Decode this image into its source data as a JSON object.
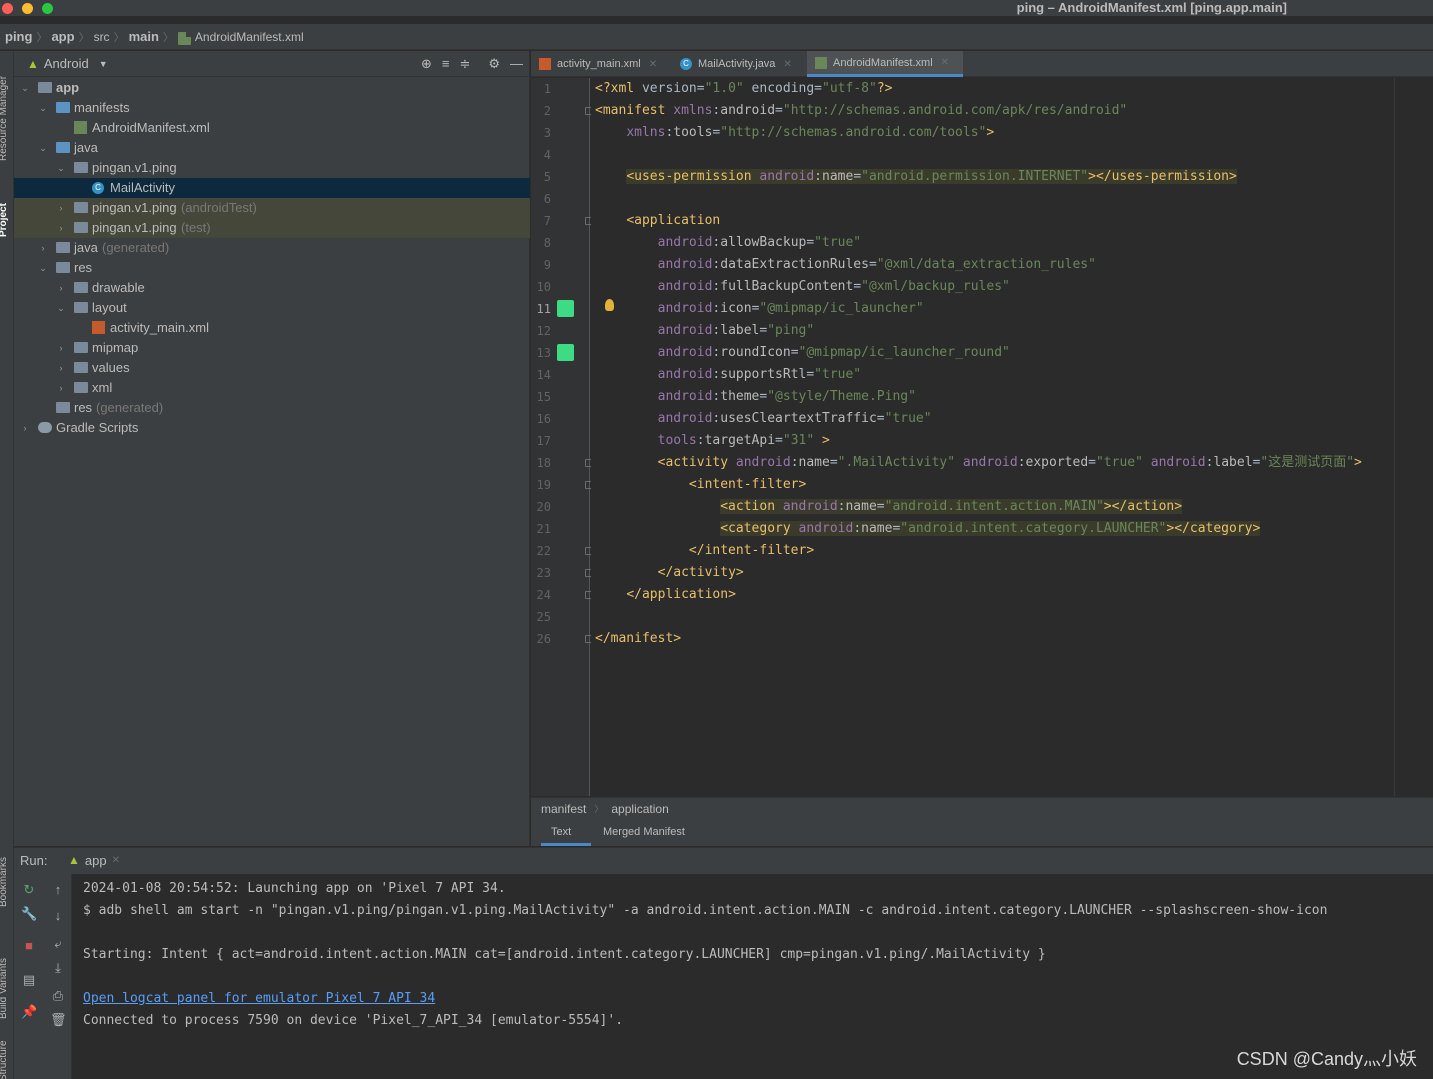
{
  "window": {
    "title": "ping – AndroidManifest.xml [ping.app.main]"
  },
  "navbar": {
    "crumbs": [
      "ping",
      "app",
      "src",
      "main",
      "AndroidManifest.xml"
    ]
  },
  "left_stripe": {
    "tabs": [
      "Resource Manager",
      "Project",
      "Bookmarks",
      "Build Variants",
      "Structure"
    ]
  },
  "project_panel": {
    "view": "Android",
    "tree": [
      {
        "label": "app",
        "extra": "",
        "depth": 0,
        "expanded": true,
        "icon": "module-folder-icon"
      },
      {
        "label": "manifests",
        "extra": "",
        "depth": 1,
        "expanded": true,
        "icon": "folder-icon"
      },
      {
        "label": "AndroidManifest.xml",
        "extra": "",
        "depth": 2,
        "expanded": null,
        "icon": "manifest-file-icon"
      },
      {
        "label": "java",
        "extra": "",
        "depth": 1,
        "expanded": true,
        "icon": "folder-icon"
      },
      {
        "label": "pingan.v1.ping",
        "extra": "",
        "depth": 2,
        "expanded": true,
        "icon": "package-icon"
      },
      {
        "label": "MailActivity",
        "extra": "",
        "depth": 3,
        "expanded": null,
        "icon": "class-icon"
      },
      {
        "label": "pingan.v1.ping",
        "extra": "(androidTest)",
        "depth": 2,
        "expanded": false,
        "icon": "package-icon"
      },
      {
        "label": "pingan.v1.ping",
        "extra": "(test)",
        "depth": 2,
        "expanded": false,
        "icon": "package-icon"
      },
      {
        "label": "java",
        "extra": "(generated)",
        "depth": 1,
        "expanded": false,
        "icon": "generated-folder-icon"
      },
      {
        "label": "res",
        "extra": "",
        "depth": 1,
        "expanded": true,
        "icon": "res-folder-icon"
      },
      {
        "label": "drawable",
        "extra": "",
        "depth": 2,
        "expanded": false,
        "icon": "folder-icon"
      },
      {
        "label": "layout",
        "extra": "",
        "depth": 2,
        "expanded": true,
        "icon": "folder-icon"
      },
      {
        "label": "activity_main.xml",
        "extra": "",
        "depth": 3,
        "expanded": null,
        "icon": "layout-file-icon"
      },
      {
        "label": "mipmap",
        "extra": "",
        "depth": 2,
        "expanded": false,
        "icon": "folder-icon"
      },
      {
        "label": "values",
        "extra": "",
        "depth": 2,
        "expanded": false,
        "icon": "folder-icon"
      },
      {
        "label": "xml",
        "extra": "",
        "depth": 2,
        "expanded": false,
        "icon": "folder-icon"
      },
      {
        "label": "res",
        "extra": "(generated)",
        "depth": 1,
        "expanded": null,
        "icon": "res-folder-icon"
      },
      {
        "label": "Gradle Scripts",
        "extra": "",
        "depth": 0,
        "expanded": false,
        "icon": "gradle-icon"
      }
    ]
  },
  "editor": {
    "tabs": [
      {
        "label": "activity_main.xml",
        "icon": "layout-file-icon",
        "active": false
      },
      {
        "label": "MailActivity.java",
        "icon": "class-icon",
        "active": false
      },
      {
        "label": "AndroidManifest.xml",
        "icon": "manifest-file-icon",
        "active": true
      }
    ],
    "current_line": 11,
    "lines": [
      "<?xml version=\"1.0\" encoding=\"utf-8\"?>",
      "<manifest xmlns:android=\"http://schemas.android.com/apk/res/android\"",
      "    xmlns:tools=\"http://schemas.android.com/tools\">",
      "",
      "    <uses-permission android:name=\"android.permission.INTERNET\"></uses-permission>",
      "",
      "    <application",
      "        android:allowBackup=\"true\"",
      "        android:dataExtractionRules=\"@xml/data_extraction_rules\"",
      "        android:fullBackupContent=\"@xml/backup_rules\"",
      "        android:icon=\"@mipmap/ic_launcher\"",
      "        android:label=\"ping\"",
      "        android:roundIcon=\"@mipmap/ic_launcher_round\"",
      "        android:supportsRtl=\"true\"",
      "        android:theme=\"@style/Theme.Ping\"",
      "        android:usesCleartextTraffic=\"true\"",
      "        tools:targetApi=\"31\" >",
      "        <activity android:name=\".MailActivity\" android:exported=\"true\" android:label=\"这是测试页面\">",
      "            <intent-filter>",
      "                <action android:name=\"android.intent.action.MAIN\"></action>",
      "                <category android:name=\"android.intent.category.LAUNCHER\"></category>",
      "            </intent-filter>",
      "        </activity>",
      "    </application>",
      "",
      "</manifest>"
    ],
    "breadcrumb": [
      "manifest",
      "application"
    ],
    "bottom_tabs": [
      {
        "label": "Text",
        "active": true
      },
      {
        "label": "Merged Manifest",
        "active": false
      }
    ]
  },
  "run_panel": {
    "label": "Run:",
    "tab": "app",
    "console": [
      {
        "text": "2024-01-08 20:54:52: Launching app on 'Pixel 7 API 34.",
        "link": false
      },
      {
        "text": "$ adb shell am start -n \"pingan.v1.ping/pingan.v1.ping.MailActivity\" -a android.intent.action.MAIN -c android.intent.category.LAUNCHER --splashscreen-show-icon",
        "link": false
      },
      {
        "text": "",
        "link": false
      },
      {
        "text": "Starting: Intent { act=android.intent.action.MAIN cat=[android.intent.category.LAUNCHER] cmp=pingan.v1.ping/.MailActivity }",
        "link": false
      },
      {
        "text": "",
        "link": false
      },
      {
        "text": "Open logcat panel for emulator Pixel 7 API 34",
        "link": true
      },
      {
        "text": "Connected to process 7590 on device 'Pixel_7_API_34 [emulator-5554]'.",
        "link": false
      }
    ]
  },
  "watermark": "CSDN @Candy灬小妖",
  "colors": {
    "accent": "#4a88c7",
    "tag": "#e8bf6a",
    "namespace": "#9876aa",
    "value": "#6a8759",
    "android_green": "#3ddc84"
  }
}
